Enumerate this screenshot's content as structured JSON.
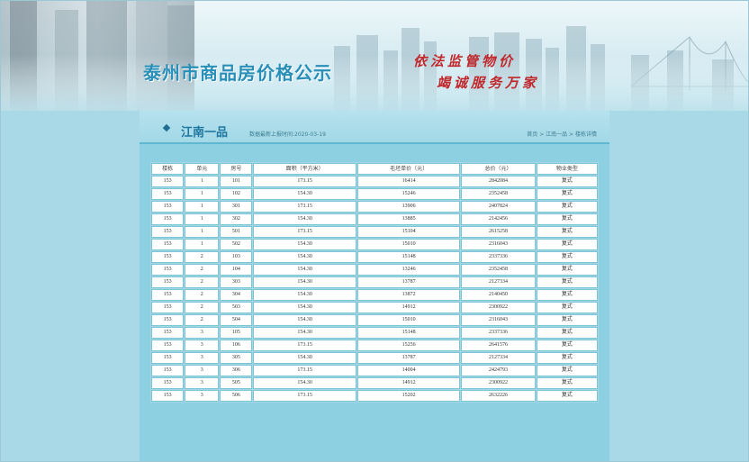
{
  "banner": {
    "site_title": "泰州市商品房价格公示",
    "slogan_line1": "依法监管物价",
    "slogan_line2": "竭诚服务万家"
  },
  "panel": {
    "title": "江南一品",
    "update_label": "数据最新上报时间:",
    "update_date": "2020-03-19",
    "breadcrumb": [
      "首页",
      "江南一品",
      "楼栋详情"
    ],
    "breadcrumb_sep": " > "
  },
  "table": {
    "headers": [
      "楼栋",
      "单元",
      "房号",
      "面积（平方米）",
      "毛坯单价（元）",
      "总价（元）",
      "物业类型"
    ],
    "rows": [
      [
        "153",
        "1",
        "101",
        "173.15",
        "16414",
        "2842084",
        "复式"
      ],
      [
        "153",
        "1",
        "102",
        "154.30",
        "15246",
        "2352458",
        "复式"
      ],
      [
        "153",
        "1",
        "301",
        "173.15",
        "13906",
        "2407824",
        "复式"
      ],
      [
        "153",
        "1",
        "302",
        "154.30",
        "13885",
        "2142456",
        "复式"
      ],
      [
        "153",
        "1",
        "501",
        "173.15",
        "15104",
        "2615258",
        "复式"
      ],
      [
        "153",
        "1",
        "502",
        "154.30",
        "15010",
        "2316043",
        "复式"
      ],
      [
        "153",
        "2",
        "103",
        "154.30",
        "15148",
        "2337336",
        "复式"
      ],
      [
        "153",
        "2",
        "104",
        "154.30",
        "13246",
        "2352458",
        "复式"
      ],
      [
        "153",
        "2",
        "303",
        "154.30",
        "13787",
        "2127334",
        "复式"
      ],
      [
        "153",
        "2",
        "304",
        "154.30",
        "13872",
        "2140450",
        "复式"
      ],
      [
        "153",
        "2",
        "503",
        "154.30",
        "14912",
        "2300922",
        "复式"
      ],
      [
        "153",
        "2",
        "504",
        "154.30",
        "15010",
        "2316043",
        "复式"
      ],
      [
        "153",
        "3",
        "105",
        "154.30",
        "15148",
        "2337336",
        "复式"
      ],
      [
        "153",
        "3",
        "106",
        "173.15",
        "15256",
        "2641576",
        "复式"
      ],
      [
        "153",
        "3",
        "305",
        "154.30",
        "13787",
        "2127334",
        "复式"
      ],
      [
        "153",
        "3",
        "306",
        "173.15",
        "14004",
        "2424793",
        "复式"
      ],
      [
        "153",
        "3",
        "505",
        "154.30",
        "14912",
        "2300922",
        "复式"
      ],
      [
        "153",
        "3",
        "506",
        "173.15",
        "15202",
        "2632226",
        "复式"
      ]
    ]
  },
  "colors": {
    "accent": "#2a8fb8",
    "slogan": "#c0282c",
    "panel_bg": "#8cd0e1",
    "page_bg": "#a9d9e7"
  }
}
